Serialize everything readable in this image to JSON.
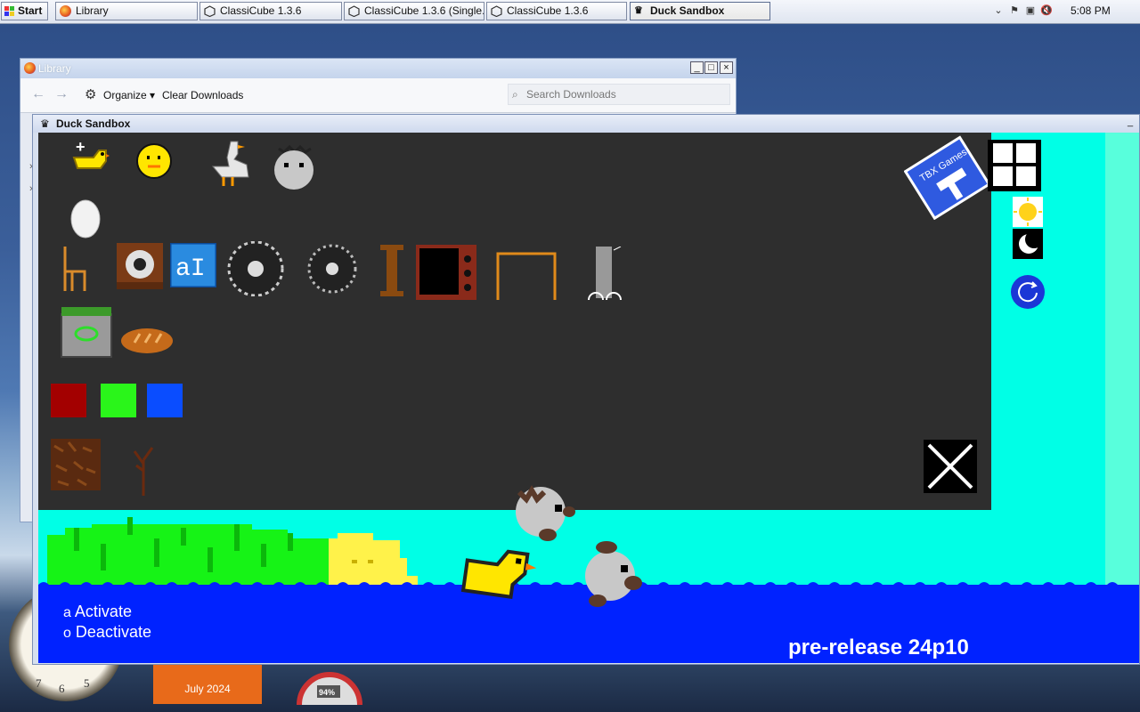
{
  "taskbar": {
    "start_label": "Start",
    "buttons": [
      {
        "label": "Library"
      },
      {
        "label": "ClassiCube 1.3.6"
      },
      {
        "label": "ClassiCube 1.3.6 (Single..."
      },
      {
        "label": "ClassiCube 1.3.6"
      },
      {
        "label": "Duck Sandbox"
      }
    ],
    "clock": "5:08 PM"
  },
  "library": {
    "title": "Library",
    "toolbar": {
      "organize_label": "Organize",
      "clear_label": "Clear Downloads",
      "search_placeholder": "Search Downloads"
    },
    "window_buttons": {
      "minimize": "_",
      "maximize": "□",
      "close": "×"
    }
  },
  "duck_window": {
    "title": "Duck Sandbox",
    "minimize": "_"
  },
  "game": {
    "logo_text": "TBX Games",
    "hints": [
      {
        "key": "a",
        "label": "Activate"
      },
      {
        "key": "o",
        "label": "Deactivate"
      }
    ],
    "version": "pre-release 24p10",
    "colors": {
      "panel": "#2e2e2e",
      "sky": "#00ffe6",
      "water": "#0022ff",
      "red_swatch": "#a30000",
      "green_swatch": "#2af51a",
      "blue_swatch": "#0a4dff"
    },
    "palette_icons": [
      "add-duck-icon",
      "chick-icon",
      "goose-icon",
      "owl-icon",
      "egg-icon",
      "chair-icon",
      "speaker-icon",
      "ai-block-icon",
      "saw-blade-large-icon",
      "saw-blade-small-icon",
      "pillar-icon",
      "tv-icon",
      "table-icon",
      "guitar-icon",
      "trash-bin-icon",
      "bread-icon",
      "dirt-block-icon",
      "sapling-icon"
    ]
  },
  "desktop": {
    "calendar_label": "July 2024",
    "gauge_label": "94%"
  }
}
